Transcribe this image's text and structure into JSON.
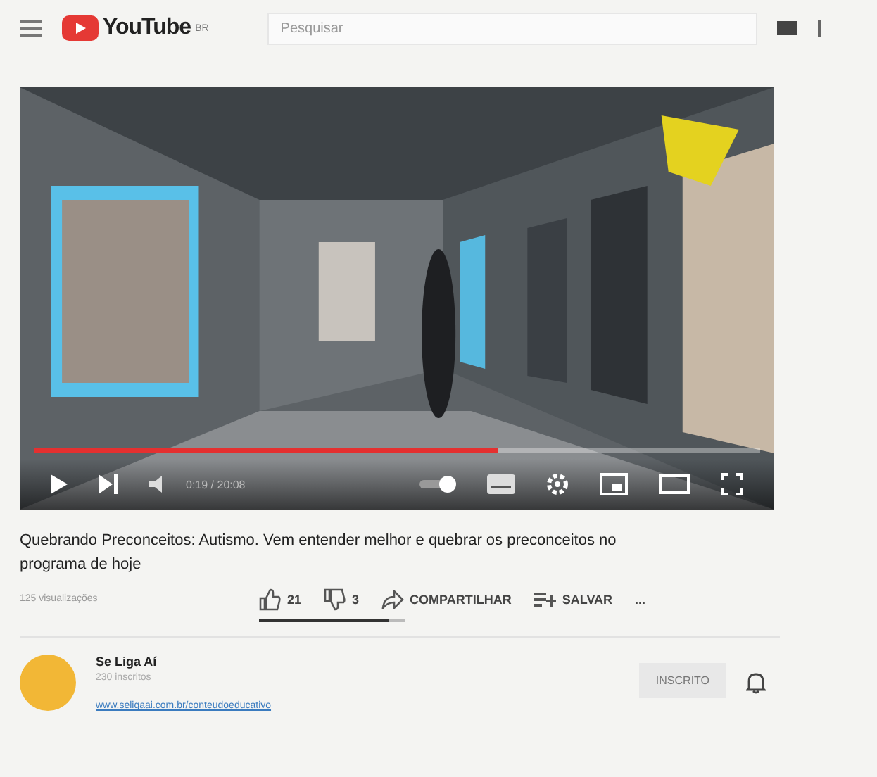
{
  "header": {
    "logo": "YouTube",
    "region": "BR",
    "search": {
      "placeholder": "Pesquisar"
    }
  },
  "player": {
    "progress": {
      "level": 0.64
    },
    "time": "0:19 / 20:08"
  },
  "video": {
    "title": "Quebrando Preconceitos: Autismo. Vem entender melhor e quebrar os preconceitos no programa de hoje",
    "views": "125 visualizações",
    "actions": [
      {
        "kind": "like",
        "label": "21"
      },
      {
        "kind": "dislike",
        "label": "3"
      },
      {
        "kind": "share",
        "label": "COMPARTILHAR"
      },
      {
        "kind": "save",
        "label": "SALVAR"
      },
      {
        "kind": "more",
        "label": "..."
      }
    ],
    "like_ratio": {
      "level": 0.88
    }
  },
  "channel": {
    "name": "Se Liga Aí",
    "subscribers": "230 inscritos",
    "subscribe_button": "INSCRITO",
    "link": "www.seligaai.com.br/conteudoeducativo"
  }
}
